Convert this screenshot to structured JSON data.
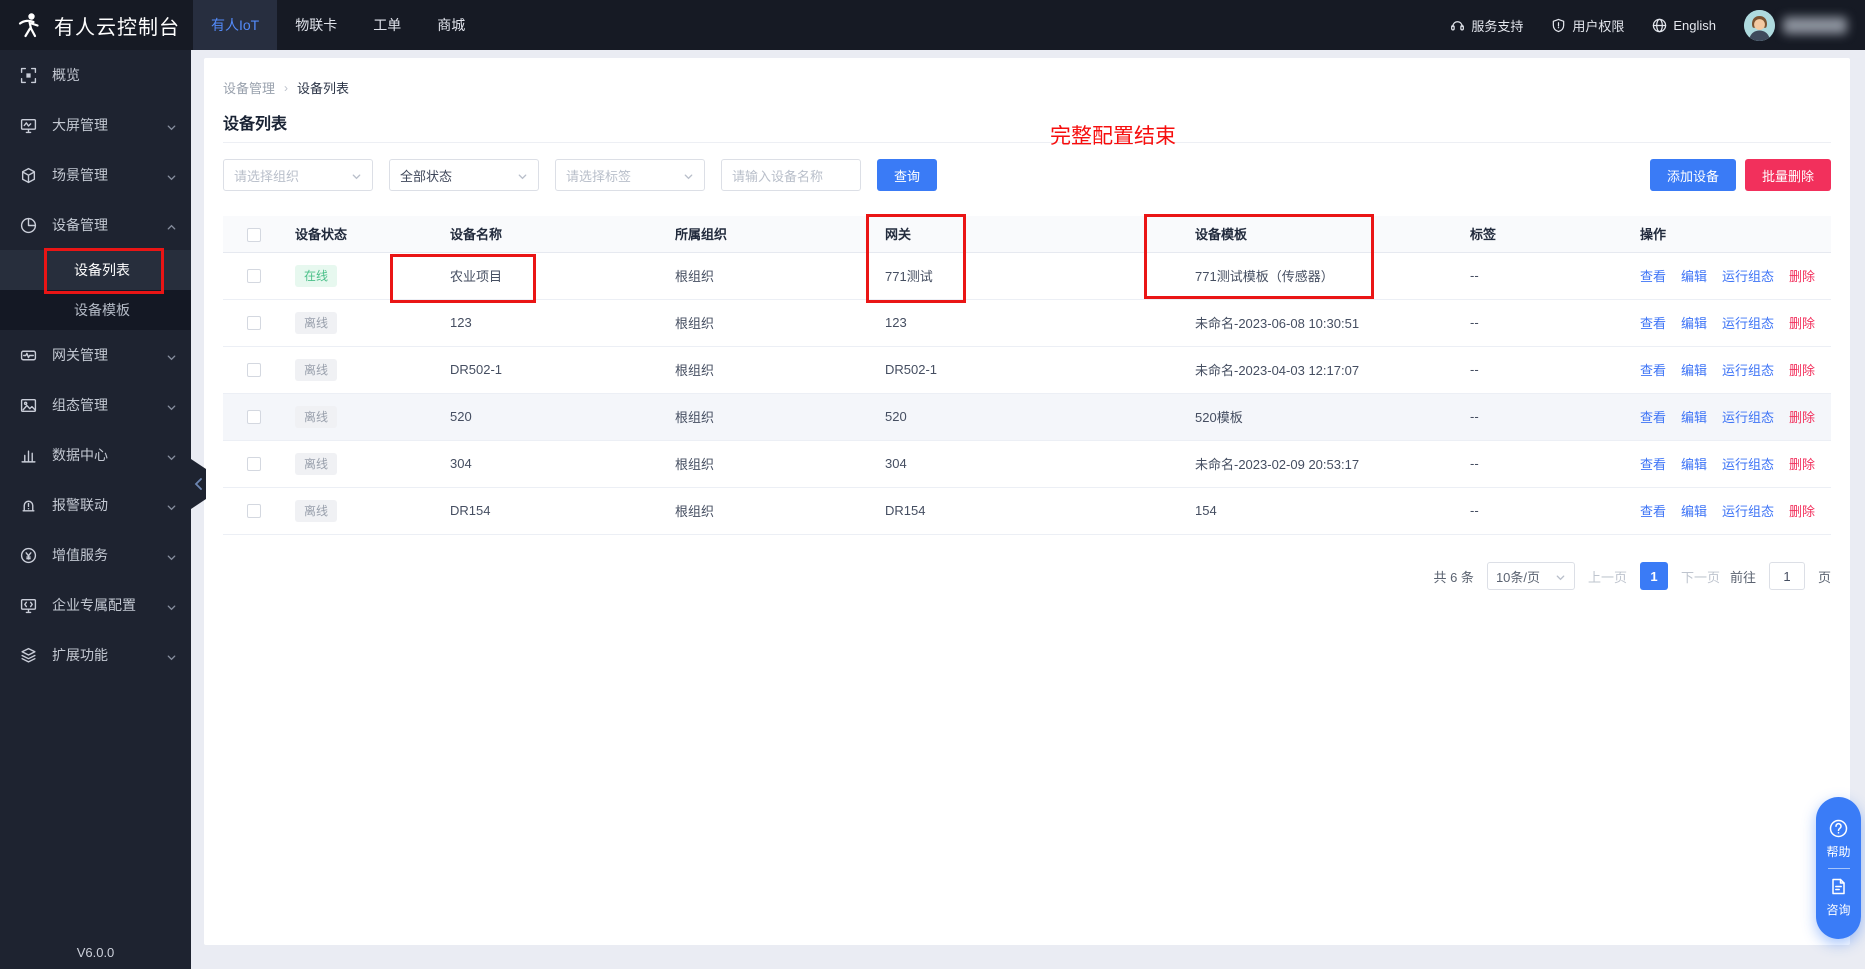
{
  "topbar": {
    "logo_text": "有人云控制台",
    "tabs": [
      {
        "label": "有人IoT",
        "active": true
      },
      {
        "label": "物联卡",
        "active": false
      },
      {
        "label": "工单",
        "active": false
      },
      {
        "label": "商城",
        "active": false
      }
    ],
    "actions": [
      {
        "icon": "headset-icon",
        "label": "服务支持"
      },
      {
        "icon": "shield-icon",
        "label": "用户权限"
      },
      {
        "icon": "globe-icon",
        "label": "English"
      }
    ]
  },
  "sidebar": {
    "version": "V6.0.0",
    "items": [
      {
        "icon": "overview-icon",
        "label": "概览",
        "expandable": false
      },
      {
        "icon": "screen-icon",
        "label": "大屏管理",
        "expandable": true
      },
      {
        "icon": "scene-icon",
        "label": "场景管理",
        "expandable": true
      },
      {
        "icon": "device-icon",
        "label": "设备管理",
        "expandable": true,
        "expanded": true,
        "children": [
          {
            "label": "设备列表",
            "active": true
          },
          {
            "label": "设备模板",
            "active": false
          }
        ]
      },
      {
        "icon": "gateway-icon",
        "label": "网关管理",
        "expandable": true
      },
      {
        "icon": "scada-icon",
        "label": "组态管理",
        "expandable": true
      },
      {
        "icon": "data-icon",
        "label": "数据中心",
        "expandable": true
      },
      {
        "icon": "alarm-icon",
        "label": "报警联动",
        "expandable": true
      },
      {
        "icon": "clock-icon",
        "label": "增值服务",
        "expandable": true
      },
      {
        "icon": "enterprise-icon",
        "label": "企业专属配置",
        "expandable": true
      },
      {
        "icon": "layers-icon",
        "label": "扩展功能",
        "expandable": true
      }
    ]
  },
  "breadcrumb": {
    "parent": "设备管理",
    "current": "设备列表"
  },
  "page": {
    "title": "设备列表"
  },
  "annotation": {
    "text": "完整配置结束"
  },
  "filters": {
    "org_placeholder": "请选择组织",
    "status_value": "全部状态",
    "tag_placeholder": "请选择标签",
    "name_placeholder": "请输入设备名称",
    "search_label": "查询"
  },
  "toolbar": {
    "add_label": "添加设备",
    "batch_delete_label": "批量删除"
  },
  "table": {
    "headers": [
      "设备状态",
      "设备名称",
      "所属组织",
      "网关",
      "设备模板",
      "标签",
      "操作"
    ],
    "action_labels": [
      "查看",
      "编辑",
      "运行组态",
      "删除"
    ],
    "rows": [
      {
        "status": "在线",
        "online": true,
        "name": "农业项目",
        "org": "根组织",
        "gateway": "771测试",
        "template": "771测试模板（传感器）",
        "tag": "--",
        "highlight": false
      },
      {
        "status": "离线",
        "online": false,
        "name": "123",
        "org": "根组织",
        "gateway": "123",
        "template": "未命名-2023-06-08 10:30:51",
        "tag": "--",
        "highlight": false
      },
      {
        "status": "离线",
        "online": false,
        "name": "DR502-1",
        "org": "根组织",
        "gateway": "DR502-1",
        "template": "未命名-2023-04-03 12:17:07",
        "tag": "--",
        "highlight": false
      },
      {
        "status": "离线",
        "online": false,
        "name": "520",
        "org": "根组织",
        "gateway": "520",
        "template": "520模板",
        "tag": "--",
        "highlight": true
      },
      {
        "status": "离线",
        "online": false,
        "name": "304",
        "org": "根组织",
        "gateway": "304",
        "template": "未命名-2023-02-09 20:53:17",
        "tag": "--",
        "highlight": false
      },
      {
        "status": "离线",
        "online": false,
        "name": "DR154",
        "org": "根组织",
        "gateway": "DR154",
        "template": "154",
        "tag": "--",
        "highlight": false
      }
    ]
  },
  "pagination": {
    "total": "共 6 条",
    "page_size": "10条/页",
    "prev": "上一页",
    "page": "1",
    "next": "下一页",
    "goto_prefix": "前往",
    "goto_value": "1",
    "goto_suffix": "页"
  },
  "float_panel": [
    {
      "icon": "question-icon",
      "label": "帮助"
    },
    {
      "icon": "document-icon",
      "label": "咨询"
    }
  ],
  "colors": {
    "primary": "#3a7bf6",
    "danger": "#f2305c",
    "online_green": "#4cc08a",
    "annotation_red": "#ea1515",
    "topbar_bg": "#161a24",
    "sidebar_bg": "#1e2330"
  }
}
